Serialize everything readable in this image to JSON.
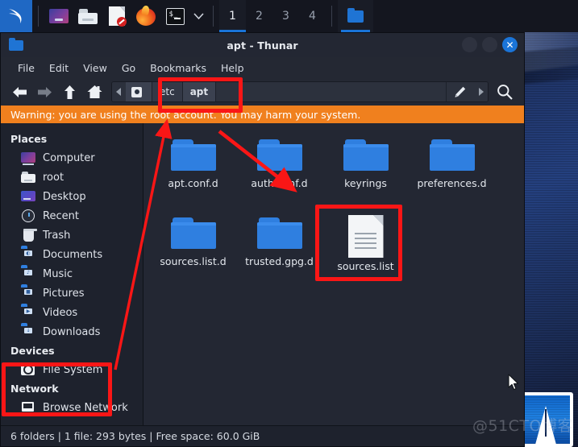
{
  "taskbar": {
    "launchers": [
      {
        "name": "kali-menu-icon",
        "label": "Kali Menu"
      },
      {
        "name": "files-manager-icon",
        "label": "File Manager"
      },
      {
        "name": "folder-icon",
        "label": "Folders"
      },
      {
        "name": "text-editor-icon",
        "label": "Text Editor"
      },
      {
        "name": "firefox-icon",
        "label": "Firefox"
      },
      {
        "name": "terminal-icon",
        "label": "Terminal"
      }
    ],
    "terminal_prompt": "$_",
    "chevron": "▾",
    "workspaces": [
      {
        "label": "1",
        "active": true
      },
      {
        "label": "2",
        "active": false
      },
      {
        "label": "3",
        "active": false
      },
      {
        "label": "4",
        "active": false
      }
    ],
    "task_button": {
      "name": "thunar-task-button",
      "label": ""
    }
  },
  "window": {
    "title": "apt - Thunar",
    "controls": {
      "minimize": "",
      "maximize": "",
      "close": "✕"
    },
    "menus": [
      "File",
      "Edit",
      "View",
      "Go",
      "Bookmarks",
      "Help"
    ]
  },
  "toolbar": {
    "back": "←",
    "forward": "→",
    "up": "↑",
    "home": "⌂",
    "scroll_left": "◂",
    "scroll_right": "▸",
    "edit_path": "pencil",
    "search": "search",
    "breadcrumbs": [
      {
        "label": "",
        "name": "breadcrumb-filesystem",
        "active": false
      },
      {
        "label": "etc",
        "name": "breadcrumb-etc",
        "active": false
      },
      {
        "label": "apt",
        "name": "breadcrumb-apt",
        "active": true
      }
    ]
  },
  "warning": {
    "text": "Warning: you are using the root account. You may harm your system.",
    "color": "#f0801e"
  },
  "sidebar": {
    "sections": [
      {
        "header": "Places",
        "items": [
          {
            "label": "Computer",
            "icon": "computer-icon"
          },
          {
            "label": "root",
            "icon": "home-folder-icon"
          },
          {
            "label": "Desktop",
            "icon": "desktop-icon"
          },
          {
            "label": "Recent",
            "icon": "recent-clock-icon"
          },
          {
            "label": "Trash",
            "icon": "trash-icon"
          },
          {
            "label": "Documents",
            "icon": "documents-folder-icon"
          },
          {
            "label": "Music",
            "icon": "music-folder-icon"
          },
          {
            "label": "Pictures",
            "icon": "pictures-folder-icon"
          },
          {
            "label": "Videos",
            "icon": "videos-folder-icon"
          },
          {
            "label": "Downloads",
            "icon": "downloads-folder-icon"
          }
        ]
      },
      {
        "header": "Devices",
        "items": [
          {
            "label": "File System",
            "icon": "drive-icon"
          }
        ]
      },
      {
        "header": "Network",
        "items": [
          {
            "label": "Browse Network",
            "icon": "network-icon"
          }
        ]
      }
    ]
  },
  "files": [
    {
      "name": "apt.conf.d",
      "type": "folder"
    },
    {
      "name": "auth.conf.d",
      "type": "folder"
    },
    {
      "name": "keyrings",
      "type": "folder"
    },
    {
      "name": "preferences.d",
      "type": "folder"
    },
    {
      "name": "sources.list.d",
      "type": "folder"
    },
    {
      "name": "trusted.gpg.d",
      "type": "folder"
    },
    {
      "name": "sources.list",
      "type": "file"
    }
  ],
  "statusbar": {
    "text": "6 folders  |  1 file: 293 bytes  |  Free space: 60.0 GiB"
  },
  "annotations": {
    "color": "#fa1616",
    "boxes": [
      {
        "name": "highlight-breadcrumb-etc-apt"
      },
      {
        "name": "highlight-sources-list"
      },
      {
        "name": "highlight-file-system"
      }
    ],
    "arrows": [
      {
        "name": "arrow-filesystem-to-breadcrumb"
      },
      {
        "name": "arrow-to-file-area"
      }
    ]
  },
  "watermark": {
    "text": "@51CTO博客"
  }
}
